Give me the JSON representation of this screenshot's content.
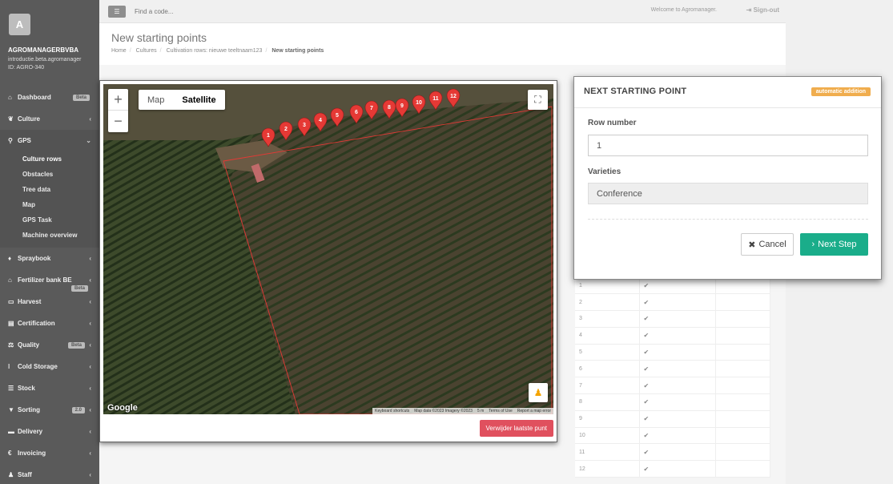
{
  "sidebar": {
    "avatar_letter": "A",
    "company": "AGROMANAGERBVBA",
    "company_sub1": "introductie.beta.agromanager",
    "company_sub2": "ID: AGRO-340",
    "items": [
      {
        "label": "Dashboard",
        "icon": "home-icon",
        "badge": "Beta"
      },
      {
        "label": "Culture",
        "icon": "leaf-icon"
      },
      {
        "label": "GPS",
        "icon": "map-marker-icon",
        "open": true
      },
      {
        "label": "Spraybook",
        "icon": "drop-icon"
      },
      {
        "label": "Fertilizer bank BE",
        "icon": "bank-icon",
        "badge": "Beta"
      },
      {
        "label": "Harvest",
        "icon": "basket-icon"
      },
      {
        "label": "Certification",
        "icon": "certificate-icon"
      },
      {
        "label": "Quality",
        "icon": "balance-icon",
        "badge": "Beta"
      },
      {
        "label": "Cold Storage",
        "icon": "thermometer-icon"
      },
      {
        "label": "Stock",
        "icon": "list-icon"
      },
      {
        "label": "Sorting",
        "icon": "filter-icon",
        "badge": "2.0"
      },
      {
        "label": "Delivery",
        "icon": "truck-icon"
      },
      {
        "label": "Invoicing",
        "icon": "euro-icon"
      },
      {
        "label": "Staff",
        "icon": "user-icon"
      }
    ],
    "gps_sub": [
      "Culture rows",
      "Obstacles",
      "Tree data",
      "Map",
      "GPS Task",
      "Machine overview"
    ]
  },
  "topbar": {
    "search_placeholder": "Find a code...",
    "welcome": "Welcome to Agromanager.",
    "signout": "Sign-out"
  },
  "page": {
    "title": "New starting points",
    "breadcrumb": [
      "Home",
      "Cultures",
      "Cultivation rows: nieuwe teeltnaam123",
      "New starting points"
    ]
  },
  "map": {
    "zoom_in": "+",
    "zoom_out": "−",
    "type_map": "Map",
    "type_satellite": "Satellite",
    "google": "Google",
    "attribution": [
      "Keyboard shortcuts",
      "Map data ©2023 Imagery ©2023",
      "5 m",
      "Terms of Use",
      "Report a map error"
    ],
    "markers": [
      "1",
      "2",
      "3",
      "4",
      "5",
      "6",
      "7",
      "8",
      "9",
      "10",
      "11",
      "12"
    ],
    "delete_button": "Verwijder laatste punt"
  },
  "table": {
    "rows": [
      "1",
      "2",
      "3",
      "4",
      "5",
      "6",
      "7",
      "8",
      "9",
      "10",
      "11",
      "12"
    ],
    "check": "✔"
  },
  "modal": {
    "title": "NEXT STARTING POINT",
    "badge": "automatic addition",
    "row_label": "Row number",
    "row_value": "1",
    "varieties_label": "Varieties",
    "varieties_value": "Conference",
    "cancel": "Cancel",
    "next": "Next Step"
  },
  "colors": {
    "sidebar": "#5a5a5a",
    "marker": "#e53935",
    "badge": "#f0ad4e",
    "next": "#1aad8a",
    "delete": "#e0505e"
  }
}
